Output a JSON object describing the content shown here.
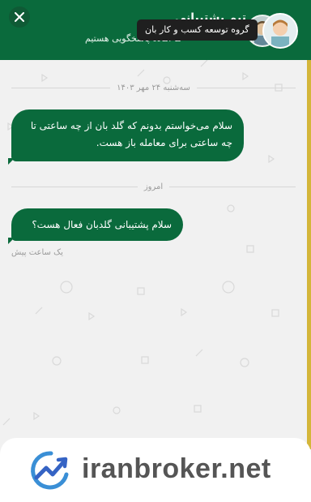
{
  "header": {
    "close_label": "×",
    "tooltip": "گروه توسعه کسب و کار بان",
    "team_title": "تیم پشتیبانی",
    "subtitle": "ما آماده پاسخگویی هستیم"
  },
  "conversation": {
    "date_divider": "سه‌شنبه ۲۴ مهر ۱۴۰۳",
    "messages": [
      {
        "text": "سلام می‌خواستم بدونم که گلد بان از چه ساعتی تا چه ساعتی برای معامله باز هست."
      },
      {
        "text": "سلام پشتیبانی گلدبان فعال هست؟"
      }
    ],
    "today_divider": "امروز",
    "last_time": "یک ساعت پیش"
  },
  "footer": {
    "brand": "iranbroker.net"
  },
  "colors": {
    "primary": "#0a6a3c",
    "background": "#f1f1f1",
    "accent_strip": "#d4b63a"
  }
}
